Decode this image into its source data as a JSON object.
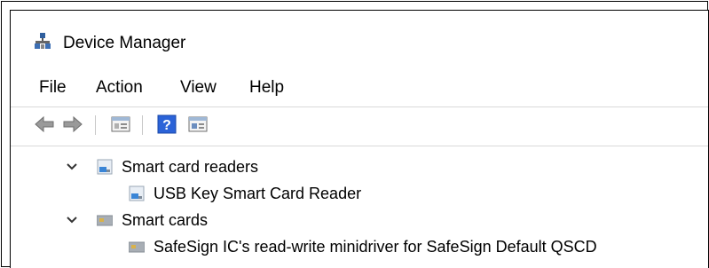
{
  "window": {
    "title": "Device Manager"
  },
  "menu": {
    "items": [
      "File",
      "Action",
      "View",
      "Help"
    ]
  },
  "toolbar": {
    "buttons": [
      "back-arrow-icon",
      "forward-arrow-icon",
      "properties-icon",
      "help-icon",
      "show-hidden-icon"
    ]
  },
  "tree": {
    "categories": [
      {
        "label": "Smart card readers",
        "expanded": true,
        "icon": "smart-card-reader-icon",
        "children": [
          {
            "label": "USB Key Smart Card Reader",
            "icon": "smart-card-reader-icon"
          }
        ]
      },
      {
        "label": "Smart cards",
        "expanded": true,
        "icon": "smart-card-icon",
        "children": [
          {
            "label": "SafeSign IC's read-write minidriver for SafeSign Default QSCD",
            "icon": "smart-card-icon"
          }
        ]
      }
    ]
  },
  "colors": {
    "help_blue": "#2b63d8",
    "arrow_gray": "#8a8a8a"
  }
}
